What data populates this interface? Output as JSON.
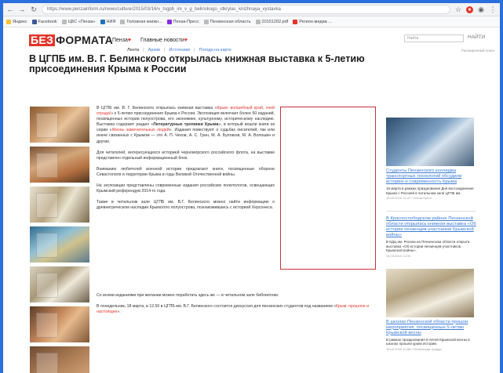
{
  "browser": {
    "url": "https://www.penzainform.ru/news/culture/2015/03/16/v_tsgpb_im_v_g_belinskogo_otkrylas_knizhnaya_vystavka",
    "bookmarks": [
      "Яндекс",
      "Facebook",
      "ЦБС «Пенза»",
      "НИЯ",
      "Головная книжн...",
      "Пенза-Пресс",
      "Пензенская область",
      "20151202.pdf",
      "Регион-медиа ..."
    ]
  },
  "site": {
    "logo_prefix": "БЕЗ",
    "logo_rest": "ФОРМАТА",
    "city": "Пенза",
    "news_menu": "Главные новости",
    "heart": "♥",
    "subnav": [
      "Лента",
      "Архив",
      "Источники",
      "Погода на карте"
    ],
    "search_placeholder": "Найти",
    "search_button": "НАЙТИ",
    "advanced_search": "Расширенный поиск"
  },
  "article": {
    "title": "В ЦГПБ им. В. Г. Белинского открылась книжная выставка к 5-летию присоединения Крыма к России",
    "p1_a": "В ЦГПБ им. В. Г. Белинского открылась книжная выставка «",
    "p1_link": "Крым: волшебный край, очей отрада!",
    "p1_b": "» к 5-летию присоединения Крыма к России. Экспозиция включает более 50 изданий, посвященных истории полуострова, его экономике, культурному, историческому наследию. Выставка содержит раздел «",
    "p1_bold": "Литературные тропинки Крыма",
    "p1_c": "», в который вошли книги из серии «",
    "p1_link2": "Жизнь замечательных людей",
    "p1_d": "». Издания повествуют о судьбах писателей, так или иначе связанных с Крымом — это А. П. Чехов, А. С. Грин, М. А. Булгаков, М. А. Волошин и другие.",
    "p2": "Для читателей, интересующихся историей черноморского российского флота, на выставке представлен отдельный информационный блок.",
    "p3": "Вниманию любителей военной истории предлагают книги, посвященные обороне Севастополя и территории Крыма в годы Великой Отечественной войны.",
    "p4": "На экспозиции представлены современные издания российских политологов, освещающих Крымский референдум 2014-го года.",
    "p5": "Также в читальном зале ЦГПБ им. В.Г. Белинского можно найти информацию о древнегреческом наследии Крымского полуострова, познакомившись с историей Херсонеса.",
    "p6": "Со всеми изданиями при желании можно поработать здесь же — в читальном зале библиотеки.",
    "p7_a": "В понедельник, 18 марта, в 12.50 в ЦГПБ им. В.Г. Белинского состоится дискуссия для пензенских студентов под названием «",
    "p7_link": "Крым: прошлое и настоящее",
    "p7_b": "»."
  },
  "sidebar": [
    {
      "title": "Студенты Пензенского колледжа транспортных технологий обсудили историю и современность Крыма",
      "desc": "15 марта в рамках празднования Дня воссоединения Крыма с Россией в читальном зале ЦГПБ им.",
      "date": "15.03.2019 12:47 / Пенза-Пресс"
    },
    {
      "title": "В Краснослободском районе Пензенской области открылась книжная выставка «Об истории пензенцев-участников Крымской войны»",
      "desc": "В КДЦ им. Росина на Пензенском области открыта выставка «Об истории пензенцев-участников Крымской войны».",
      "date": "15.03.2019 11:05"
    },
    {
      "title": "В школах Пензенской области прошли мероприятия, посвященные 5-летию Крымской весны",
      "desc": "В рамках празднования 5-летия Крымской весны в школах прошли уроки истории.",
      "date": "15.03.2019 10:58 / Пензенская правда"
    }
  ]
}
